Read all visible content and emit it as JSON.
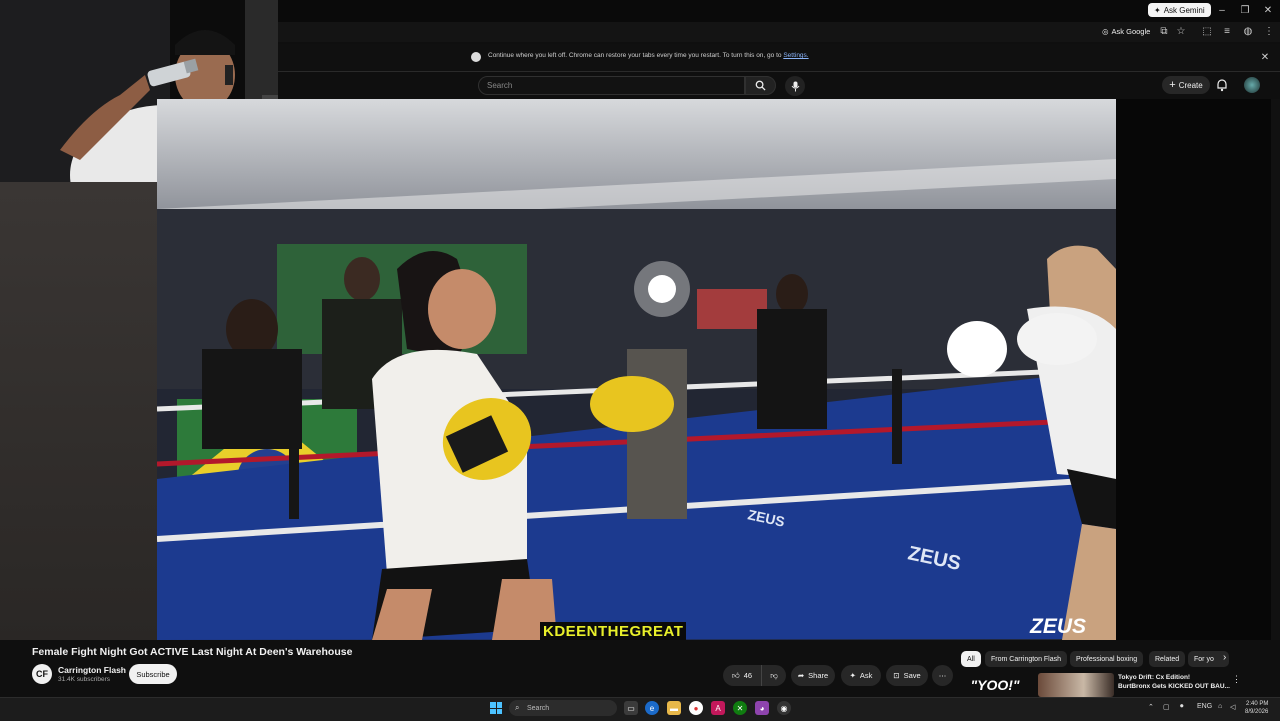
{
  "browser": {
    "ask_gemini_label": "Ask Gemini",
    "ask_google_label": "Ask Google",
    "restore_message": "Continue where you left off. Chrome can restore your tabs every time you restart. To turn this on, go to",
    "restore_link": "Settings."
  },
  "header": {
    "search_placeholder": "Search",
    "create_label": "Create"
  },
  "video": {
    "title": "Female Fight Night Got ACTIVE Last Night At Deen's Warehouse",
    "overlay_tag": "KDEENTHEGREAT",
    "sponsor_logo": "ZEUS",
    "mat_text": "ZEUS"
  },
  "channel": {
    "avatar_text": "CF",
    "name": "Carrington Flash",
    "subscribers": "31.4K subscribers",
    "subscribe_label": "Subscribe"
  },
  "actions": {
    "likes": "46",
    "share": "Share",
    "ask": "Ask",
    "save": "Save"
  },
  "chips": [
    "All",
    "From Carrington Flash",
    "Professional boxing",
    "Related",
    "For yo"
  ],
  "recommendation": {
    "thumb_text": "\"YOO!\"",
    "title_line1": "Tokyo Drift: Cx Edition!",
    "title_line2": "BurtBronx Gets KICKED OUT BAU..."
  },
  "taskbar": {
    "search_placeholder": "Search",
    "language": "ENG",
    "time": "2:40 PM",
    "date": "8/9/2026"
  },
  "colors": {
    "glove_yellow": "#e8c51f",
    "mat_blue": "#1c3a8f",
    "rope_red": "#b3182b",
    "accent_blue": "#3ea6ff"
  }
}
